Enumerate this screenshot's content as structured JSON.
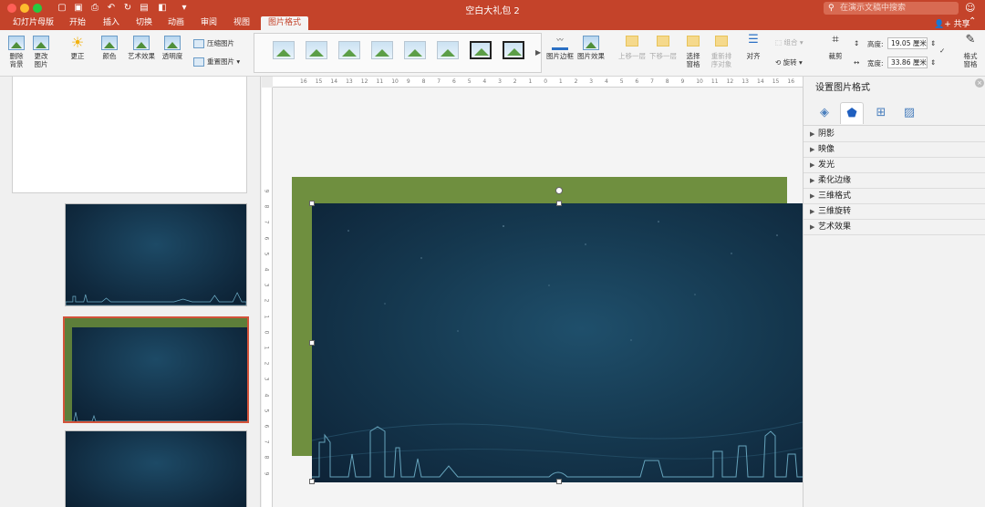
{
  "window": {
    "title": "空白大礼包 2"
  },
  "search": {
    "placeholder": "在演示文稿中搜索"
  },
  "tabs": [
    "幻灯片母版",
    "开始",
    "插入",
    "切换",
    "动画",
    "审阅",
    "视图",
    "图片格式"
  ],
  "active_tab": "图片格式",
  "share_label": "共享",
  "ribbon": {
    "remove_bg": [
      "删除",
      "背景"
    ],
    "change_pic": [
      "更改",
      "图片"
    ],
    "corrections": "更正",
    "color": "颜色",
    "artistic": "艺术效果",
    "transparency": "透明度",
    "compress": "压缩图片",
    "reset": "重置图片",
    "border": "图片边框",
    "effects": "图片效果",
    "bring_forward": "上移一层",
    "send_backward": "下移一层",
    "selection_pane": [
      "选择",
      "窗格"
    ],
    "reorder": [
      "重新排",
      "序对象"
    ],
    "align": "对齐",
    "group": "组合",
    "rotate": "旋转",
    "crop": "裁剪",
    "height_label": "高度:",
    "height_value": "19.05 厘米",
    "width_label": "宽度:",
    "width_value": "33.86 厘米",
    "format_pane": [
      "格式",
      "窗格"
    ]
  },
  "ruler_h": [
    "16",
    "15",
    "14",
    "13",
    "12",
    "11",
    "10",
    "9",
    "8",
    "7",
    "6",
    "5",
    "4",
    "3",
    "2",
    "1",
    "0",
    "1",
    "2",
    "3",
    "4",
    "5",
    "6",
    "7",
    "8",
    "9",
    "10",
    "11",
    "12",
    "13",
    "14",
    "15",
    "16"
  ],
  "ruler_v": [
    "9",
    "8",
    "7",
    "6",
    "5",
    "4",
    "3",
    "2",
    "1",
    "0",
    "1",
    "2",
    "3",
    "4",
    "5",
    "6",
    "7",
    "8",
    "9"
  ],
  "format_pane": {
    "title": "设置图片格式",
    "sections": [
      "阴影",
      "映像",
      "发光",
      "柔化边缘",
      "三维格式",
      "三维旋转",
      "艺术效果"
    ]
  },
  "colors": {
    "accent": "#c4432a",
    "slide_green": "#6f8f3f",
    "night_blue": "#15384f"
  }
}
